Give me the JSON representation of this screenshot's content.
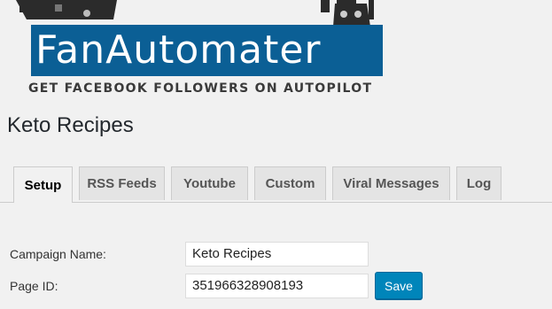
{
  "logo": {
    "name": "FanAutomater",
    "tagline": "GET FACEBOOK FOLLOWERS ON AUTOPILOT",
    "brand_color": "#0b5f95"
  },
  "page_title": "Keto Recipes",
  "tabs": [
    {
      "label": "Setup",
      "active": true
    },
    {
      "label": "RSS Feeds",
      "active": false
    },
    {
      "label": "Youtube",
      "active": false
    },
    {
      "label": "Custom",
      "active": false
    },
    {
      "label": "Viral Messages",
      "active": false
    },
    {
      "label": "Log",
      "active": false
    }
  ],
  "form": {
    "campaign_name_label": "Campaign Name:",
    "campaign_name_value": "Keto Recipes",
    "page_id_label": "Page ID:",
    "page_id_value": "351966328908193",
    "save_label": "Save"
  },
  "colors": {
    "button": "#0085ba"
  }
}
